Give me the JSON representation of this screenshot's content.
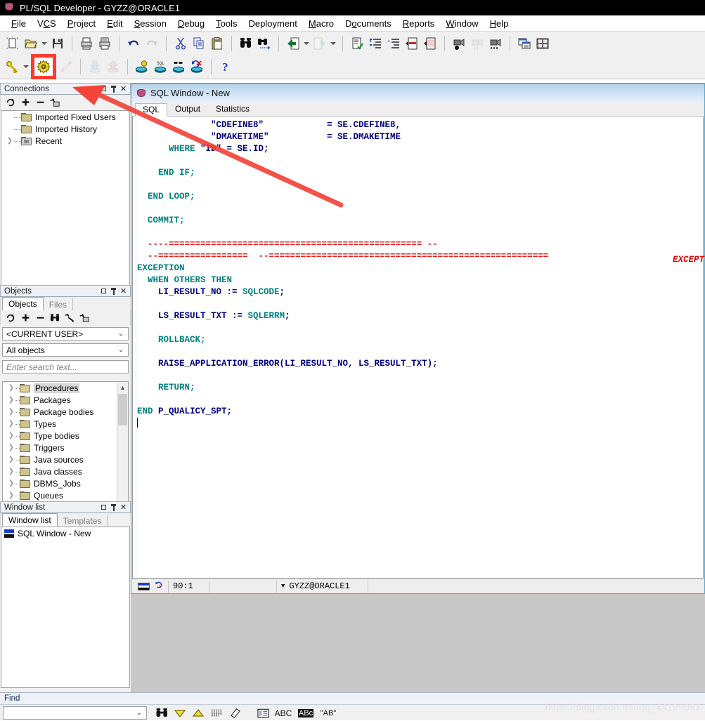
{
  "window": {
    "title": "PL/SQL Developer - GYZZ@ORACLE1",
    "app_icon": "database-icon"
  },
  "menubar": {
    "items": [
      {
        "label": "File",
        "accel": "F"
      },
      {
        "label": "VCS",
        "accel": "V"
      },
      {
        "label": "Project",
        "accel": "P"
      },
      {
        "label": "Edit",
        "accel": "E"
      },
      {
        "label": "Session",
        "accel": "S"
      },
      {
        "label": "Debug",
        "accel": "D"
      },
      {
        "label": "Tools",
        "accel": "T"
      },
      {
        "label": "Deployment",
        "accel": ""
      },
      {
        "label": "Macro",
        "accel": "M"
      },
      {
        "label": "Documents",
        "accel": "o"
      },
      {
        "label": "Reports",
        "accel": "R"
      },
      {
        "label": "Window",
        "accel": "W"
      },
      {
        "label": "Help",
        "accel": "H"
      }
    ]
  },
  "toolbar1": {
    "buttons": [
      {
        "name": "new-icon"
      },
      {
        "name": "open-folder-icon"
      },
      {
        "name": "open-dropdown-arrow"
      },
      {
        "name": "save-icon"
      },
      {
        "name": "print-icon"
      },
      {
        "name": "print-preview-icon"
      },
      {
        "name": "undo-icon"
      },
      {
        "name": "redo-icon"
      },
      {
        "name": "cut-icon"
      },
      {
        "name": "copy-icon"
      },
      {
        "name": "paste-icon"
      },
      {
        "name": "find-icon"
      },
      {
        "name": "find-next-icon"
      },
      {
        "name": "go-back-icon"
      },
      {
        "name": "go-back-dropdown-arrow"
      },
      {
        "name": "go-forward-icon"
      },
      {
        "name": "go-forward-dropdown-arrow"
      },
      {
        "name": "check-document-icon"
      },
      {
        "name": "indent-icon"
      },
      {
        "name": "outdent-icon"
      },
      {
        "name": "comment-icon"
      },
      {
        "name": "uncomment-icon"
      },
      {
        "name": "record-macro-icon"
      },
      {
        "name": "pause-macro-icon"
      },
      {
        "name": "macro-options-icon"
      },
      {
        "name": "cascade-windows-icon"
      },
      {
        "name": "tile-windows-icon"
      }
    ]
  },
  "toolbar2": {
    "buttons": [
      {
        "name": "login-key-icon"
      },
      {
        "name": "login-dropdown-arrow"
      },
      {
        "name": "gear-settings-icon",
        "highlighted": true
      },
      {
        "name": "break-connection-icon"
      },
      {
        "name": "import-icon"
      },
      {
        "name": "export-icon"
      },
      {
        "name": "test-window-icon"
      },
      {
        "name": "sql-window-icon"
      },
      {
        "name": "command-window-icon"
      },
      {
        "name": "rollback-icon"
      },
      {
        "name": "help-icon"
      }
    ]
  },
  "connections_panel": {
    "header": "Connections",
    "buttons": [
      "refresh-icon",
      "add-icon",
      "remove-icon",
      "properties-icon"
    ],
    "items": [
      {
        "label": "Imported Fixed Users",
        "icon": "folder-icon",
        "expandable": false
      },
      {
        "label": "Imported History",
        "icon": "folder-icon",
        "expandable": false
      },
      {
        "label": "Recent",
        "icon": "gray-folder-icon",
        "expandable": true
      }
    ]
  },
  "objects_panel": {
    "header": "Objects",
    "tabs": [
      {
        "label": "Objects",
        "active": true
      },
      {
        "label": "Files",
        "active": false
      }
    ],
    "buttons": [
      "refresh-icon",
      "add-icon",
      "remove-icon",
      "find-icon",
      "filter-icon",
      "properties-icon"
    ],
    "user_select": "<CURRENT USER>",
    "filter_select": "All objects",
    "search_placeholder": "Enter search text...",
    "tree": [
      {
        "label": "Procedures",
        "selected": true,
        "open": true
      },
      {
        "label": "Packages",
        "selected": false,
        "open": false
      },
      {
        "label": "Package bodies",
        "selected": false,
        "open": false
      },
      {
        "label": "Types",
        "selected": false,
        "open": false
      },
      {
        "label": "Type bodies",
        "selected": false,
        "open": false
      },
      {
        "label": "Triggers",
        "selected": false,
        "open": false
      },
      {
        "label": "Java sources",
        "selected": false,
        "open": false
      },
      {
        "label": "Java classes",
        "selected": false,
        "open": false
      },
      {
        "label": "DBMS_Jobs",
        "selected": false,
        "open": false
      },
      {
        "label": "Queues",
        "selected": false,
        "open": false
      }
    ]
  },
  "windowlist_panel": {
    "header": "Window list",
    "tabs": [
      {
        "label": "Window list",
        "active": true
      },
      {
        "label": "Templates",
        "active": false
      }
    ],
    "items": [
      {
        "label": "SQL Window - New",
        "icon": "sql-window-icon"
      }
    ]
  },
  "sql_window": {
    "title": "SQL Window - New",
    "icon": "database-icon",
    "tabs": [
      {
        "label": "SQL",
        "active": true
      },
      {
        "label": "Output",
        "active": false
      },
      {
        "label": "Statistics",
        "active": false
      }
    ],
    "code_lines": [
      "              \"CDEFINE8\"            = SE.CDEFINE8,",
      "              \"DMAKETIME\"           = SE.DMAKETIME",
      "      WHERE \"ID\" = SE.ID;",
      "",
      "    END IF;",
      "",
      "  END LOOP;",
      "",
      "  COMMIT;",
      "",
      "  ----================================================ --",
      "  --=================  --=====================================================",
      "EXCEPTION",
      "  WHEN OTHERS THEN",
      "    LI_RESULT_NO := SQLCODE;",
      "",
      "    LS_RESULT_TXT := SQLERRM;",
      "",
      "    ROLLBACK;",
      "",
      "    RAISE_APPLICATION_ERROR(LI_RESULT_NO, LS_RESULT_TXT);",
      "",
      "    RETURN;",
      "",
      "END P_QUALICY_SPT;"
    ],
    "overflow_text": "EXCEPT",
    "status": {
      "cursor_position": "90:1",
      "connection": "GYZZ@ORACLE1"
    }
  },
  "find_bar": {
    "title": "Find",
    "input_value": "",
    "buttons": [
      {
        "name": "find-binoculars-icon"
      },
      {
        "name": "find-next-down-icon"
      },
      {
        "name": "find-previous-up-icon"
      },
      {
        "name": "highlight-all-icon"
      },
      {
        "name": "clear-highlight-icon"
      },
      {
        "name": "find-in-window-icon"
      },
      {
        "name": "match-case-abc-icon",
        "label": "ABC"
      },
      {
        "name": "match-highlight-icon",
        "label": "ABc"
      },
      {
        "name": "whole-word-icon",
        "label": "\"AB\""
      }
    ]
  },
  "watermark": {
    "text": "https://blog.csdn.net/qq_44199087"
  },
  "colors": {
    "titlebar_bg": "#000000",
    "accent_blue": "#5aa8c8",
    "keyword": "#008080",
    "identifier": "#000080",
    "comment_red": "#e00000",
    "highlight_red": "#ff3b30",
    "folder_yellow": "#cfc58c"
  }
}
